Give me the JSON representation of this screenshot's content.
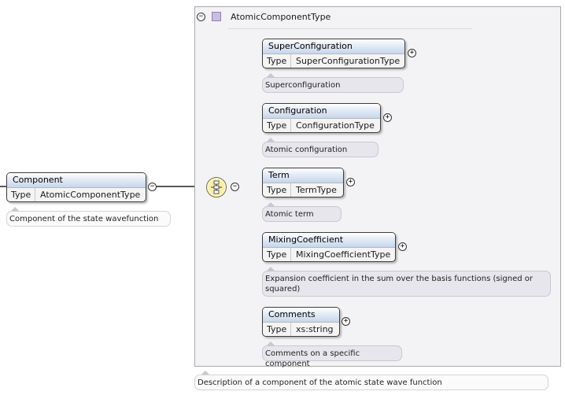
{
  "root_element": {
    "name": "Component",
    "type_key": "Type",
    "type_value": "AtomicComponentType",
    "doc": "Component of the state wavefunction",
    "toggle": "−"
  },
  "complex_type": {
    "name": "AtomicComponentType",
    "doc": "Description of a component of the atomic state wave function",
    "toggle": "−",
    "seq_toggle": "−"
  },
  "children": [
    {
      "name": "SuperConfiguration",
      "type_key": "Type",
      "type_value": "SuperConfigurationType",
      "doc": "Superconfiguration",
      "toggle": "+"
    },
    {
      "name": "Configuration",
      "type_key": "Type",
      "type_value": "ConfigurationType",
      "doc": "Atomic configuration",
      "toggle": "+"
    },
    {
      "name": "Term",
      "type_key": "Type",
      "type_value": "TermType",
      "doc": "Atomic term",
      "toggle": "+"
    },
    {
      "name": "MixingCoefficient",
      "type_key": "Type",
      "type_value": "MixingCoefficientType",
      "doc": "Expansion coefficient in the sum over the basis functions (signed or squared)",
      "toggle": "+"
    },
    {
      "name": "Comments",
      "type_key": "Type",
      "type_value": "xs:string",
      "doc": "Comments on a specific component",
      "toggle": "+"
    }
  ],
  "icons": {
    "complex_type_icon": "square-type-icon",
    "sequence_icon": "sequence-compositor-icon",
    "collapse_icon": "minus-circle-icon",
    "expand_icon": "plus-circle-icon"
  },
  "colors": {
    "element_header": "#c6d6ec",
    "sequence_fill": "#f7eea8",
    "type_icon": "#c9bde0",
    "doc_fill": "#e7e6ec"
  }
}
